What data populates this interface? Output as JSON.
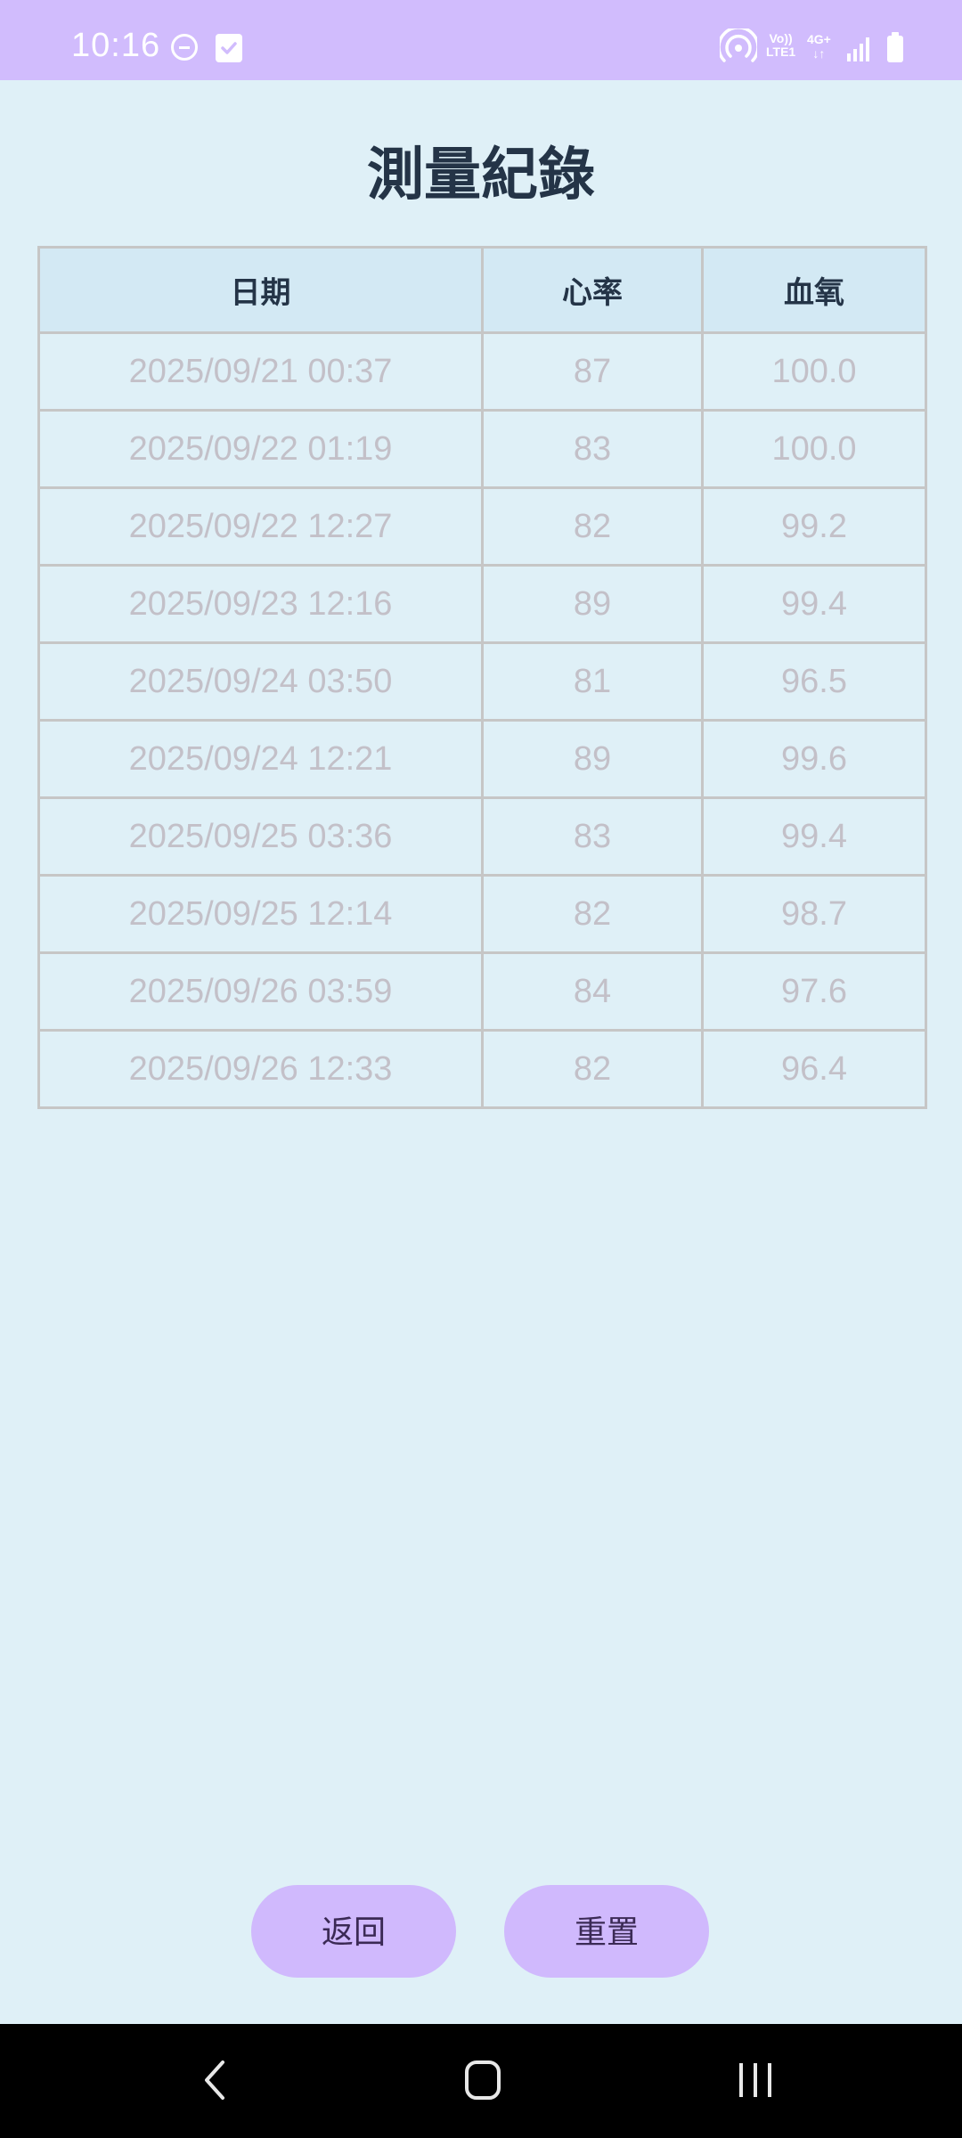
{
  "status_bar": {
    "time": "10:16",
    "volte_top": "Vo))",
    "volte_bottom": "LTE1",
    "network_type": "4G+",
    "network_arrows": "↓↑",
    "background_color": "#d1bcfd"
  },
  "page": {
    "title": "測量紀錄"
  },
  "table": {
    "headers": [
      "日期",
      "心率",
      "血氧"
    ],
    "rows": [
      [
        "2025/09/21 00:37",
        "87",
        "100.0"
      ],
      [
        "2025/09/22 01:19",
        "83",
        "100.0"
      ],
      [
        "2025/09/22 12:27",
        "82",
        "99.2"
      ],
      [
        "2025/09/23 12:16",
        "89",
        "99.4"
      ],
      [
        "2025/09/24 03:50",
        "81",
        "96.5"
      ],
      [
        "2025/09/24 12:21",
        "89",
        "99.6"
      ],
      [
        "2025/09/25 03:36",
        "83",
        "99.4"
      ],
      [
        "2025/09/25 12:14",
        "82",
        "98.7"
      ],
      [
        "2025/09/26 03:59",
        "84",
        "97.6"
      ],
      [
        "2025/09/26 12:33",
        "82",
        "96.4"
      ]
    ]
  },
  "buttons": {
    "back_label": "返回",
    "reset_label": "重置",
    "color": "#d0b9fd"
  },
  "nav_bar": {
    "back_icon": "chevron-left-icon",
    "home_icon": "rounded-square-home-icon",
    "recent_icon": "three-bars-recent-apps-icon"
  },
  "colors": {
    "background": "#dff0f7",
    "header_background": "#d3e9f4",
    "title_text": "#243447",
    "cell_text": "#c3c0c8"
  }
}
